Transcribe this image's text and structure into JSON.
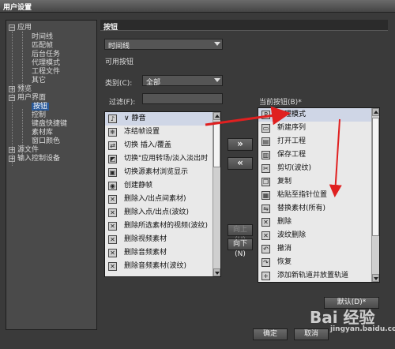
{
  "window": {
    "title": "用户设置"
  },
  "tree": {
    "items": [
      {
        "label": "应用",
        "expander": "−"
      },
      {
        "label": "时间线"
      },
      {
        "label": "匹配帧"
      },
      {
        "label": "后台任务"
      },
      {
        "label": "代理模式"
      },
      {
        "label": "工程文件"
      },
      {
        "label": "其它"
      },
      {
        "label": "预览",
        "expander": "+"
      },
      {
        "label": "用户界面",
        "expander": "−"
      },
      {
        "label": "按钮"
      },
      {
        "label": "控制"
      },
      {
        "label": "键盘快捷键"
      },
      {
        "label": "素材库"
      },
      {
        "label": "窗口颜色"
      },
      {
        "label": "源文件",
        "expander": "+"
      },
      {
        "label": "输入控制设备",
        "expander": "+"
      }
    ]
  },
  "panel": {
    "title": "按钮",
    "target_select": "时间线",
    "available_label": "可用按钮",
    "category_label": "类别(C):",
    "category_value": "全部",
    "filter_label": "过滤(F):",
    "current_label": "当前按钮(B)*"
  },
  "available": [
    {
      "label": "∨ 静音",
      "icon": "mute-icon"
    },
    {
      "label": "冻结帧设置",
      "icon": "freeze-frame-icon"
    },
    {
      "label": "切换 插入/覆盖",
      "icon": "insert-overwrite-icon"
    },
    {
      "label": "切换\"应用转场/淡入淡出时",
      "icon": "transition-icon"
    },
    {
      "label": "切换源素材浏览显示",
      "icon": "source-view-icon"
    },
    {
      "label": "创建静帧",
      "icon": "still-frame-icon"
    },
    {
      "label": "删除入/出点间素材)",
      "icon": "delete-inout-icon"
    },
    {
      "label": "删除入点/出点(波纹)",
      "icon": "ripple-delete-inout-icon"
    },
    {
      "label": "删除所选素材的视频(波纹)",
      "icon": "delete-video-ripple-icon"
    },
    {
      "label": "删除视频素材",
      "icon": "delete-video-icon"
    },
    {
      "label": "删除音频素材",
      "icon": "delete-audio-icon"
    },
    {
      "label": "删除音频素材(波纹)",
      "icon": "delete-audio-ripple-icon"
    }
  ],
  "current": [
    {
      "label": "代理模式",
      "icon": "proxy-icon"
    },
    {
      "label": "新建序列",
      "icon": "new-sequence-icon"
    },
    {
      "label": "打开工程",
      "icon": "open-project-icon"
    },
    {
      "label": "保存工程",
      "icon": "save-project-icon"
    },
    {
      "label": "剪切(波纹)",
      "icon": "cut-icon"
    },
    {
      "label": "复制",
      "icon": "copy-icon"
    },
    {
      "label": "粘贴至指针位置",
      "icon": "paste-icon"
    },
    {
      "label": "替换素材(所有)",
      "icon": "replace-icon"
    },
    {
      "label": "删除",
      "icon": "delete-icon"
    },
    {
      "label": "波纹删除",
      "icon": "ripple-delete-icon"
    },
    {
      "label": "撤消",
      "icon": "undo-icon"
    },
    {
      "label": "恢复",
      "icon": "redo-icon"
    },
    {
      "label": "添加新轨道并放置轨道",
      "icon": "add-track-icon"
    }
  ],
  "buttons": {
    "add": "»",
    "remove": "«",
    "move_up": "向上(U)",
    "move_down": "向下(N)",
    "default": "默认(D)*",
    "ok": "确定",
    "cancel": "取消"
  },
  "watermark": {
    "text": "Bai 经验",
    "sub": "jingyan.baidu.com"
  },
  "colors": {
    "highlight": "#2a5a9a",
    "arrow": "#e02020"
  }
}
